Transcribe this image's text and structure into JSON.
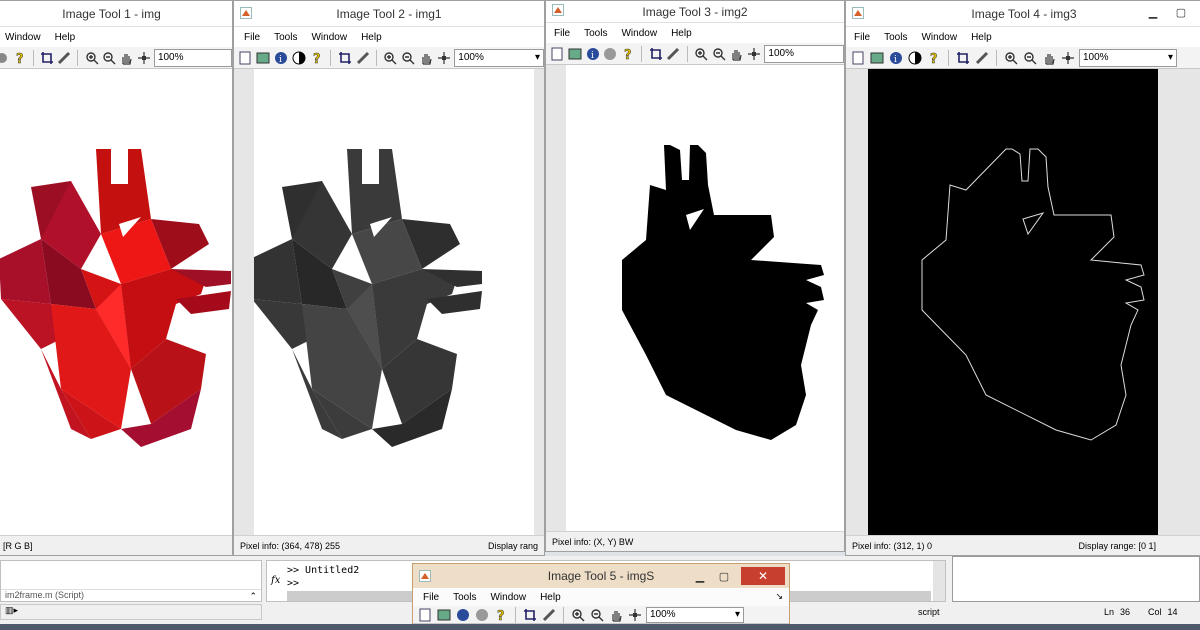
{
  "windows": {
    "w1": {
      "title": "Image Tool 1 - img",
      "menu": [
        "Window",
        "Help"
      ],
      "zoom": "100%",
      "status_left": "[R G B]",
      "status_right": ""
    },
    "w2": {
      "title": "Image Tool 2 - img1",
      "menu": [
        "File",
        "Tools",
        "Window",
        "Help"
      ],
      "zoom": "100%",
      "status_left": "Pixel info: (364, 478)  255",
      "status_right": "Display rang"
    },
    "w3": {
      "title": "Image Tool 3 - img2",
      "menu": [
        "File",
        "Tools",
        "Window",
        "Help"
      ],
      "zoom": "100%",
      "status_left": "Pixel info: (X, Y)  BW",
      "status_right": ""
    },
    "w4": {
      "title": "Image Tool 4 - img3",
      "menu": [
        "File",
        "Tools",
        "Window",
        "Help"
      ],
      "zoom": "100%",
      "status_left": "Pixel info: (312, 1)  0",
      "status_right": "Display range: [0 1]"
    },
    "w5": {
      "title": "Image Tool 5 - imgS",
      "menu": [
        "File",
        "Tools",
        "Window",
        "Help"
      ],
      "zoom": "100%"
    }
  },
  "matlab": {
    "file_label": "im2frame.m (Script)",
    "cmd_line1": ">> Untitled2",
    "cmd_line2": ">>",
    "fx": "fx",
    "status_mode": "script",
    "ln_label": "Ln",
    "ln": "36",
    "col_label": "Col",
    "col": "14"
  },
  "colors": {
    "red_heart": "#d01010",
    "gray_heart": "#3e3e3e",
    "accent": "#c7402e"
  }
}
